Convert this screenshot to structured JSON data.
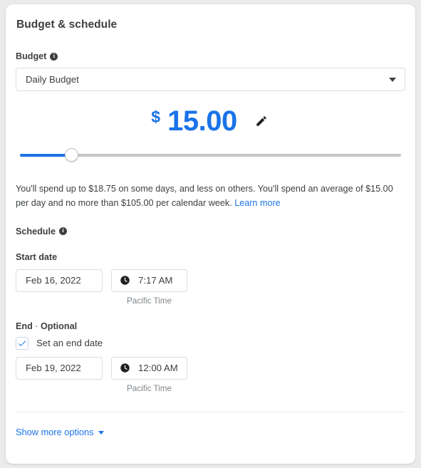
{
  "card": {
    "section_title": "Budget & schedule"
  },
  "budget": {
    "label": "Budget",
    "info_icon": "info-icon",
    "type_select": {
      "value": "Daily Budget",
      "caret_icon": "chevron-down-icon"
    },
    "currency_symbol": "$",
    "amount": "15.00",
    "edit_icon": "pencil-icon",
    "slider": {
      "fill_percent": 13.5
    },
    "note_part1": "You'll spend up to $18.75 on some days, and less on others. You'll spend an average of $15.00 per day and no more than $105.00 per calendar week. ",
    "note_link": "Learn more"
  },
  "schedule": {
    "label": "Schedule",
    "info_icon": "info-icon",
    "start": {
      "label": "Start date",
      "date": "Feb 16, 2022",
      "time": "7:17 AM",
      "clock_icon": "clock-icon",
      "timezone": "Pacific Time"
    },
    "end": {
      "label": "End",
      "optional": "Optional",
      "separator": "·",
      "checkbox_label": "Set an end date",
      "checkbox_checked": true,
      "check_icon": "check-icon",
      "date": "Feb 19, 2022",
      "time": "12:00 AM",
      "clock_icon": "clock-icon",
      "timezone": "Pacific Time"
    }
  },
  "footer": {
    "show_more_label": "Show more options",
    "caret_icon": "chevron-down-icon"
  },
  "colors": {
    "accent_blue": "#1a73e8",
    "text_primary": "#3c4043",
    "text_muted": "#80868b",
    "border": "#dadce0",
    "track_gray": "#c4c7c5"
  }
}
